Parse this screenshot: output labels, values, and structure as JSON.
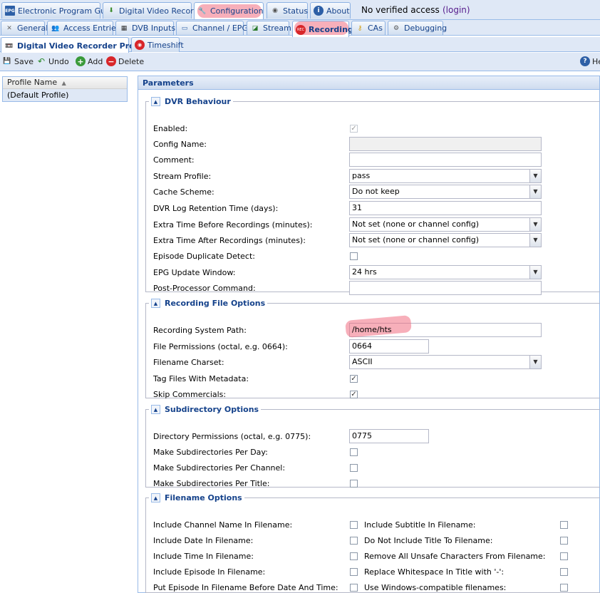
{
  "nav": {
    "main_tabs": [
      {
        "label": "Electronic Program Guide",
        "icon": "epg-icon"
      },
      {
        "label": "Digital Video Recorder",
        "icon": "download-icon"
      },
      {
        "label": "Configuration",
        "icon": "wrench-icon"
      },
      {
        "label": "Status",
        "icon": "eye-icon"
      },
      {
        "label": "About",
        "icon": "info-icon"
      }
    ],
    "access_text": "No verified access",
    "login_text": "(login)",
    "config_tabs": [
      {
        "label": "General",
        "icon": "tools-icon"
      },
      {
        "label": "Access Entries",
        "icon": "users-icon"
      },
      {
        "label": "DVB Inputs",
        "icon": "film-icon"
      },
      {
        "label": "Channel / EPG",
        "icon": "tv-icon"
      },
      {
        "label": "Stream",
        "icon": "stream-icon"
      },
      {
        "label": "Recording",
        "icon": "rec-icon"
      },
      {
        "label": "CAs",
        "icon": "key-icon"
      },
      {
        "label": "Debugging",
        "icon": "bug-icon"
      }
    ],
    "sub_tabs": [
      {
        "label": "Digital Video Recorder Profiles",
        "icon": "recorder-icon"
      },
      {
        "label": "Timeshift",
        "icon": "record-icon"
      }
    ]
  },
  "toolbar": {
    "save": "Save",
    "undo": "Undo",
    "add": "Add",
    "delete": "Delete",
    "help": "He"
  },
  "profiles": {
    "header": "Profile Name",
    "rows": [
      "(Default Profile)"
    ]
  },
  "params": {
    "title": "Parameters",
    "dvr_behaviour": {
      "legend": "DVR Behaviour",
      "enabled": {
        "label": "Enabled:",
        "checked": true
      },
      "config_name": {
        "label": "Config Name:",
        "value": ""
      },
      "comment": {
        "label": "Comment:",
        "value": ""
      },
      "stream_profile": {
        "label": "Stream Profile:",
        "value": "pass"
      },
      "cache_scheme": {
        "label": "Cache Scheme:",
        "value": "Do not keep"
      },
      "log_retention": {
        "label": "DVR Log Retention Time (days):",
        "value": "31"
      },
      "extra_before": {
        "label": "Extra Time Before Recordings (minutes):",
        "value": "Not set (none or channel config)"
      },
      "extra_after": {
        "label": "Extra Time After Recordings (minutes):",
        "value": "Not set (none or channel config)"
      },
      "dup_detect": {
        "label": "Episode Duplicate Detect:",
        "checked": false
      },
      "epg_window": {
        "label": "EPG Update Window:",
        "value": "24 hrs"
      },
      "post_processor": {
        "label": "Post-Processor Command:",
        "value": ""
      }
    },
    "recording_file": {
      "legend": "Recording File Options",
      "system_path": {
        "label": "Recording System Path:",
        "value": "/home/hts"
      },
      "file_perms": {
        "label": "File Permissions (octal, e.g. 0664):",
        "value": "0664"
      },
      "charset": {
        "label": "Filename Charset:",
        "value": "ASCII"
      },
      "tag_files": {
        "label": "Tag Files With Metadata:",
        "checked": true
      },
      "skip_commercials": {
        "label": "Skip Commercials:",
        "checked": true
      }
    },
    "subdirectory": {
      "legend": "Subdirectory Options",
      "dir_perms": {
        "label": "Directory Permissions (octal, e.g. 0775):",
        "value": "0775"
      },
      "per_day": {
        "label": "Make Subdirectories Per Day:",
        "checked": false
      },
      "per_channel": {
        "label": "Make Subdirectories Per Channel:",
        "checked": false
      },
      "per_title": {
        "label": "Make Subdirectories Per Title:",
        "checked": false
      }
    },
    "filename": {
      "legend": "Filename Options",
      "left": [
        {
          "label": "Include Channel Name In Filename:",
          "checked": false
        },
        {
          "label": "Include Date In Filename:",
          "checked": false
        },
        {
          "label": "Include Time In Filename:",
          "checked": false
        },
        {
          "label": "Include Episode In Filename:",
          "checked": false
        },
        {
          "label": "Put Episode In Filename Before Date And Time:",
          "checked": false
        }
      ],
      "right": [
        {
          "label": "Include Subtitle In Filename:",
          "checked": false
        },
        {
          "label": "Do Not Include Title To Filename:",
          "checked": false
        },
        {
          "label": "Remove All Unsafe Characters From Filename:",
          "checked": false
        },
        {
          "label": "Replace Whitespace In Title with '-':",
          "checked": false
        },
        {
          "label": "Use Windows-compatible filenames:",
          "checked": false
        }
      ]
    }
  },
  "colors": {
    "accent": "#15428b",
    "tab_bg": "#dfe8f6",
    "highlight": "#f06e82"
  }
}
